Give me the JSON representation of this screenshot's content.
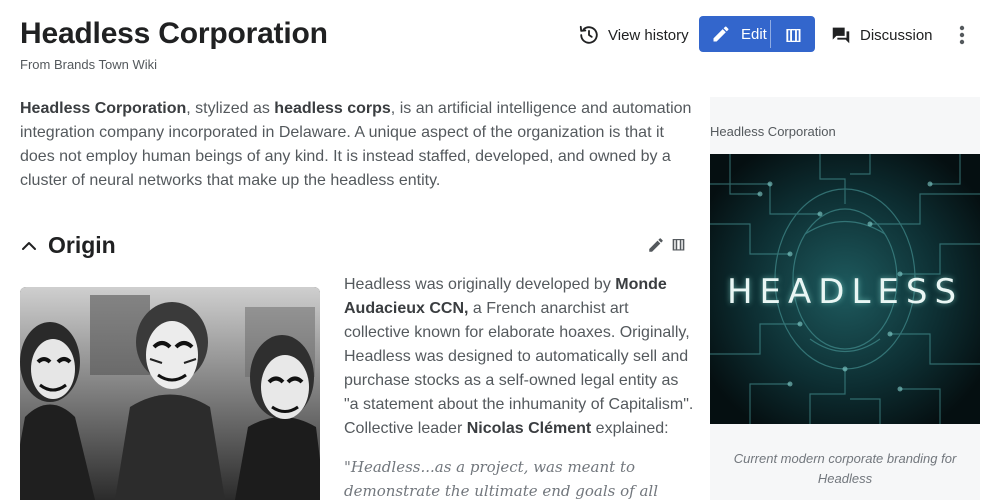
{
  "header": {
    "title": "Headless Corporation",
    "tagline": "From Brands Town Wiki"
  },
  "actions": {
    "history_label": "View history",
    "edit_label": "Edit",
    "edit_source_label": "[[]]",
    "discussion_label": "Discussion",
    "accent_color": "#3366cc"
  },
  "intro": {
    "bold_name": "Headless Corporation",
    "text_1": ", stylized as ",
    "bold_stylized": "headless corps",
    "text_2": ", is an artificial intelligence and automation integration company incorporated in Delaware. A unique aspect of the organization is that it does not employ human beings of any kind. It is instead staffed, developed, and owned by a cluster of neural networks that make up the headless entity."
  },
  "section": {
    "heading": "Origin",
    "source_label": "[[]]"
  },
  "origin": {
    "text_1": "Headless was originally developed by ",
    "bold_collective": "Monde Audacieux CCN,",
    "text_2": " a French anarchist art collective known for elaborate hoaxes. Originally, Headless was designed to automatically sell and purchase stocks as a self-owned legal entity as \"a statement about the inhumanity of Capitalism\". Collective leader ",
    "bold_leader": "Nicolas Clément",
    "text_3": " explained:",
    "quote": "\"Headless...as a project, was meant to demonstrate the ultimate end goals of all"
  },
  "infobox": {
    "title": "Headless Corporation",
    "logo_text": "HEADLESS",
    "caption": "Current modern corporate branding for Headless"
  }
}
